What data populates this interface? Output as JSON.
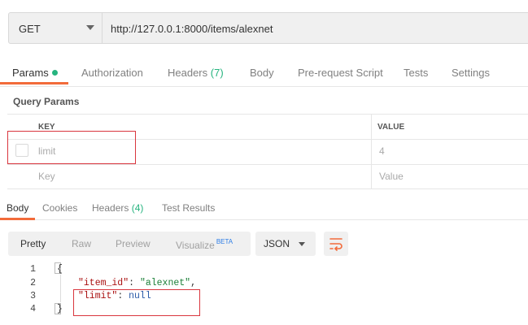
{
  "request": {
    "method": "GET",
    "url": "http://127.0.0.1:8000/items/alexnet"
  },
  "request_tabs": [
    {
      "label": "Params",
      "active": true,
      "dot": true
    },
    {
      "label": "Authorization"
    },
    {
      "label": "Headers",
      "count": "(7)"
    },
    {
      "label": "Body"
    },
    {
      "label": "Pre-request Script"
    },
    {
      "label": "Tests"
    },
    {
      "label": "Settings"
    }
  ],
  "query_params": {
    "title": "Query Params",
    "columns": {
      "key": "KEY",
      "value": "VALUE"
    },
    "rows": [
      {
        "key": "limit",
        "value": "4",
        "checked": false
      }
    ],
    "placeholder": {
      "key": "Key",
      "value": "Value"
    }
  },
  "response_tabs": [
    {
      "label": "Body",
      "active": true
    },
    {
      "label": "Cookies"
    },
    {
      "label": "Headers",
      "count": "(4)"
    },
    {
      "label": "Test Results"
    }
  ],
  "view_modes": {
    "pretty": "Pretty",
    "raw": "Raw",
    "preview": "Preview",
    "visualize": "Visualize",
    "beta": "BETA"
  },
  "format": "JSON",
  "code": {
    "line_numbers": [
      "1",
      "2",
      "3",
      "4"
    ],
    "open_brace": "{",
    "close_brace": "}",
    "line2_key": "\"item_id\"",
    "line2_value": "\"alexnet\"",
    "line3_key": "\"limit\"",
    "line3_value": "null"
  },
  "colors": {
    "accent": "#f26b3a",
    "params_dot": "#26b47f",
    "highlight_box": "#d9363e"
  }
}
